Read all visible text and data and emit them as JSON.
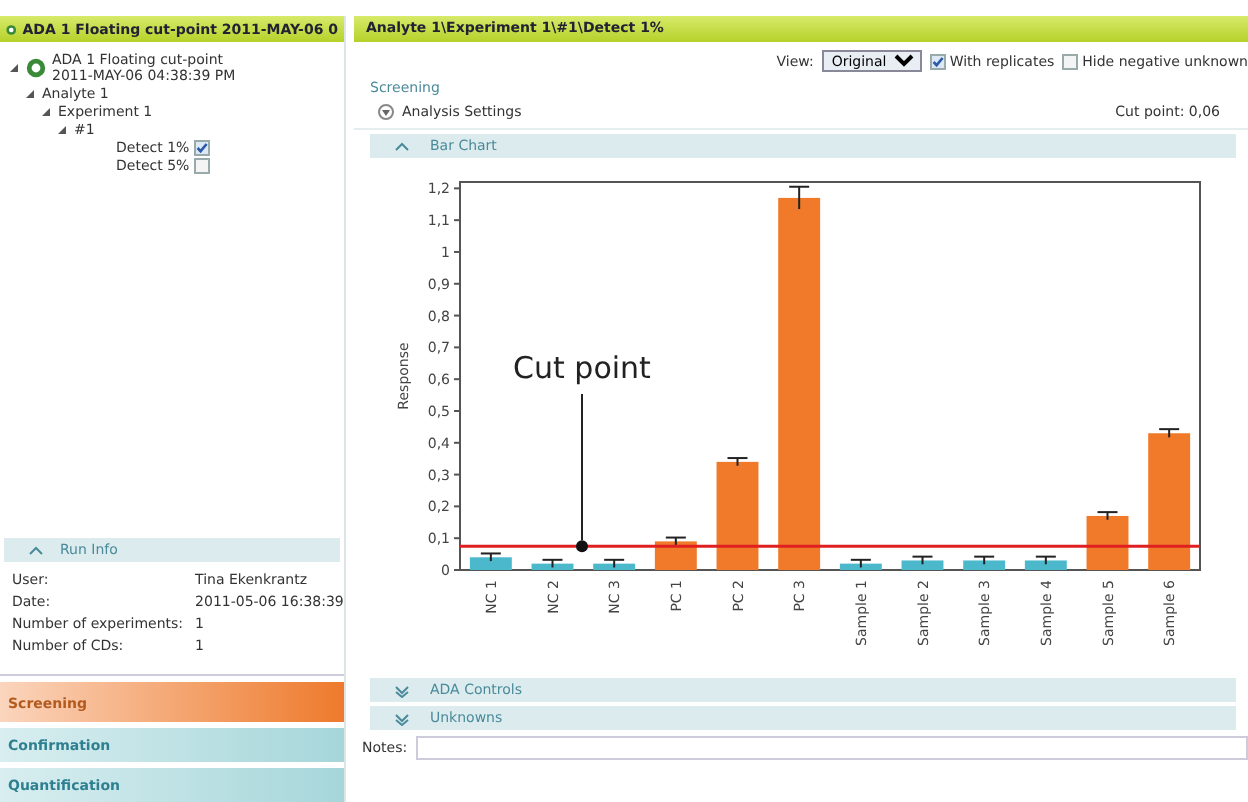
{
  "sidebar": {
    "title": "ADA 1 Floating cut-point 2011-MAY-06 0",
    "tree": [
      {
        "label": "ADA 1 Floating cut-point 2011-MAY-06 04:38:39 PM",
        "expanded": true,
        "children": [
          {
            "label": "Analyte 1",
            "expanded": true,
            "children": [
              {
                "label": "Experiment 1",
                "expanded": true,
                "children": [
                  {
                    "label": "#1",
                    "expanded": true,
                    "children": [
                      {
                        "label": "Detect 1%",
                        "checked": true
                      },
                      {
                        "label": "Detect 5%",
                        "checked": false
                      }
                    ]
                  }
                ]
              }
            ]
          }
        ]
      }
    ],
    "run_info": {
      "title": "Run Info",
      "expanded": true,
      "rows": [
        {
          "label": "User:",
          "value": "Tina Ekenkrantz"
        },
        {
          "label": "Date:",
          "value": "2011-05-06 16:38:39"
        },
        {
          "label": "Number of experiments:",
          "value": "1"
        },
        {
          "label": "Number of CDs:",
          "value": "1"
        }
      ]
    },
    "nav": [
      {
        "label": "Screening",
        "selected": true
      },
      {
        "label": "Confirmation",
        "selected": false
      },
      {
        "label": "Quantification",
        "selected": false
      }
    ]
  },
  "main": {
    "breadcrumb": "Analyte 1\\Experiment 1\\#1\\Detect 1%",
    "view_label": "View:",
    "view_value": "Original",
    "options": [
      {
        "label": "With replicates",
        "checked": true
      },
      {
        "label": "Hide negative unknown",
        "checked": false
      }
    ],
    "section": "Screening",
    "analysis_settings": "Analysis Settings",
    "cut_point": "Cut point: 0,06",
    "bar_chart": {
      "title": "Bar Chart",
      "expanded": true,
      "chart_data": {
        "type": "bar",
        "ylabel": "Response",
        "categories": [
          "NC 1",
          "NC 2",
          "NC 3",
          "PC 1",
          "PC 2",
          "PC 3",
          "Sample 1",
          "Sample 2",
          "Sample 3",
          "Sample 4",
          "Sample 5",
          "Sample 6"
        ],
        "series": [
          {
            "color": "#4bb8cc",
            "values": [
              0.04,
              0.02,
              0.02,
              null,
              null,
              null,
              0.02,
              0.03,
              0.03,
              0.03,
              null,
              null
            ]
          },
          {
            "color": "#f07a2a",
            "values": [
              null,
              null,
              null,
              0.09,
              0.34,
              1.17,
              null,
              null,
              null,
              null,
              0.17,
              0.43
            ]
          }
        ],
        "ylim": [
          0,
          1.22
        ],
        "yticks": [
          {
            "value": 0,
            "label": "0"
          },
          {
            "value": 0.1,
            "label": "0,1"
          },
          {
            "value": 0.2,
            "label": "0,2"
          },
          {
            "value": 0.3,
            "label": "0,3"
          },
          {
            "value": 0.4,
            "label": "0,4"
          },
          {
            "value": 0.5,
            "label": "0,5"
          },
          {
            "value": 0.6,
            "label": "0,6"
          },
          {
            "value": 0.7,
            "label": "0,7"
          },
          {
            "value": 0.8,
            "label": "0,8"
          },
          {
            "value": 0.9,
            "label": "0,9"
          },
          {
            "value": 1,
            "label": "1"
          },
          {
            "value": 1.1,
            "label": "1,1"
          },
          {
            "value": 1.2,
            "label": "1,2"
          }
        ],
        "ref_lines": [
          {
            "axis": "y",
            "value": 0.075,
            "label": "Cut point",
            "color": "#e02020"
          }
        ]
      }
    },
    "panels": [
      {
        "title": "ADA Controls",
        "expanded": false
      },
      {
        "title": "Unknowns",
        "expanded": false
      }
    ],
    "notes_label": "Notes:"
  }
}
